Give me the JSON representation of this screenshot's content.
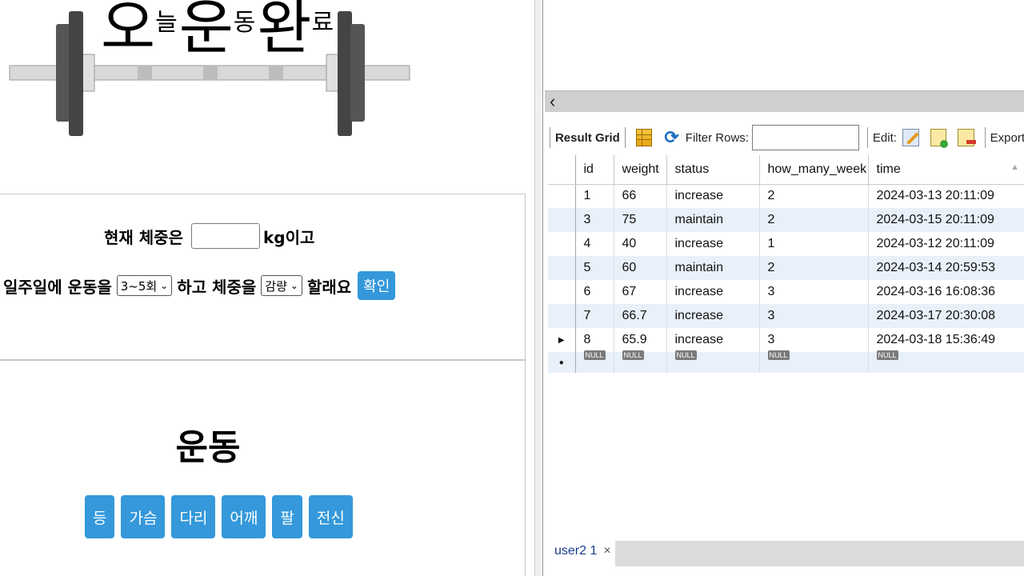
{
  "app": {
    "logo": {
      "chars": [
        "오",
        "늘",
        "운",
        "동",
        "완",
        "료"
      ]
    },
    "form": {
      "weight_prefix": "현재 체중은",
      "weight_value": "",
      "weight_suffix": "kg이고",
      "week_prefix": "일주일에 운동을",
      "frequency_selected": "3~5회",
      "mid_text": "하고 체중을",
      "goal_selected": "감량",
      "end_text": "할래요",
      "confirm_label": "확인"
    },
    "exercise": {
      "title": "운동",
      "buttons": [
        "등",
        "가슴",
        "다리",
        "어깨",
        "팔",
        "전신"
      ]
    }
  },
  "workbench": {
    "toolbar": {
      "result_grid": "Result Grid",
      "filter_rows": "Filter Rows:",
      "filter_value": "",
      "edit": "Edit:",
      "export": "Export"
    },
    "columns": [
      "id",
      "weight",
      "status",
      "how_many_week",
      "time"
    ],
    "rows": [
      [
        "1",
        "66",
        "increase",
        "2",
        "2024-03-13 20:11:09"
      ],
      [
        "3",
        "75",
        "maintain",
        "2",
        "2024-03-15 20:11:09"
      ],
      [
        "4",
        "40",
        "increase",
        "1",
        "2024-03-12 20:11:09"
      ],
      [
        "5",
        "60",
        "maintain",
        "2",
        "2024-03-14 20:59:53"
      ],
      [
        "6",
        "67",
        "increase",
        "3",
        "2024-03-16 16:08:36"
      ],
      [
        "7",
        "66.7",
        "increase",
        "3",
        "2024-03-17 20:30:08"
      ],
      [
        "8",
        "65.9",
        "increase",
        "3",
        "2024-03-18 15:36:49"
      ]
    ],
    "null_label": "NULL",
    "tab": {
      "label": "user2 1",
      "close": "×"
    }
  }
}
